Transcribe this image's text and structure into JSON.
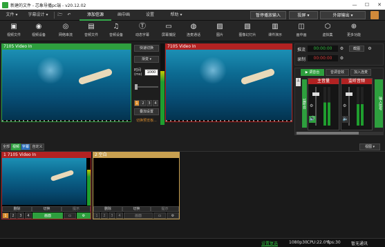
{
  "window": {
    "title": "新建的文件 - 芯象导播pc端 - v20.12.02",
    "min": "—",
    "max": "☐",
    "close": "✕"
  },
  "menu": {
    "file": "文件",
    "subtitle_design": "字幕设计",
    "tabs": [
      "添加信源",
      "画中画",
      "设置",
      "帮助"
    ],
    "stop_output": "暂停播放输入",
    "projection": "投屏",
    "external_output": "外部输出"
  },
  "toolbar": [
    "视频文件",
    "视频设备",
    "网络串流",
    "音频文件",
    "音频设备",
    "动态字幕",
    "屏幕捕捉",
    "连麦通话",
    "图片",
    "图像幻灯片",
    "课件演示",
    "画中画",
    "虚拟集",
    "更多功能"
  ],
  "preview": {
    "label": "7105 Video In"
  },
  "program": {
    "label": "7105 Video In"
  },
  "transition": {
    "quick_switch": "快速切换",
    "mode": "渐变",
    "time_label": "时间\n(ms)",
    "time_value": "1000",
    "pages": [
      "1",
      "2",
      "3",
      "4"
    ],
    "overlay": "叠加设置",
    "hint": "切换预览板..."
  },
  "stream": {
    "push": "推流",
    "record": "录制",
    "push_time": "00:00:00",
    "record_time": "00:00:00",
    "snapshot": "截图"
  },
  "audio": {
    "tabs": [
      "调音台",
      "音调音效",
      "加入连麦"
    ],
    "master": "主音量",
    "monitor": "监听音频",
    "side_left": "监听台",
    "side_right": "输入信号"
  },
  "sources": {
    "tabs": [
      "全部",
      "视频",
      "字幕",
      "自定义"
    ],
    "view": "视图",
    "cards": [
      {
        "title": "1 7105 Video In",
        "delete": "删除",
        "switch": "切换",
        "hint": "提示",
        "pages": [
          "1",
          "2",
          "3",
          "4"
        ],
        "live": "画面"
      },
      {
        "title": "2 空白",
        "delete": "删除",
        "switch": "切换",
        "hint": "提示",
        "pages": [
          "1",
          "2",
          "3",
          "4"
        ],
        "live": "画面"
      }
    ]
  },
  "status": {
    "link": "设置复选",
    "resolution": "1080p30",
    "cpu": "CPU:22.0%",
    "fps": "fps:30",
    "state": "暂无通讯"
  },
  "colors": {
    "accent": "#2e9f3e",
    "program_header": "#b22222",
    "preview_header": "#2e9f3e",
    "blank_header": "#c8a050"
  }
}
